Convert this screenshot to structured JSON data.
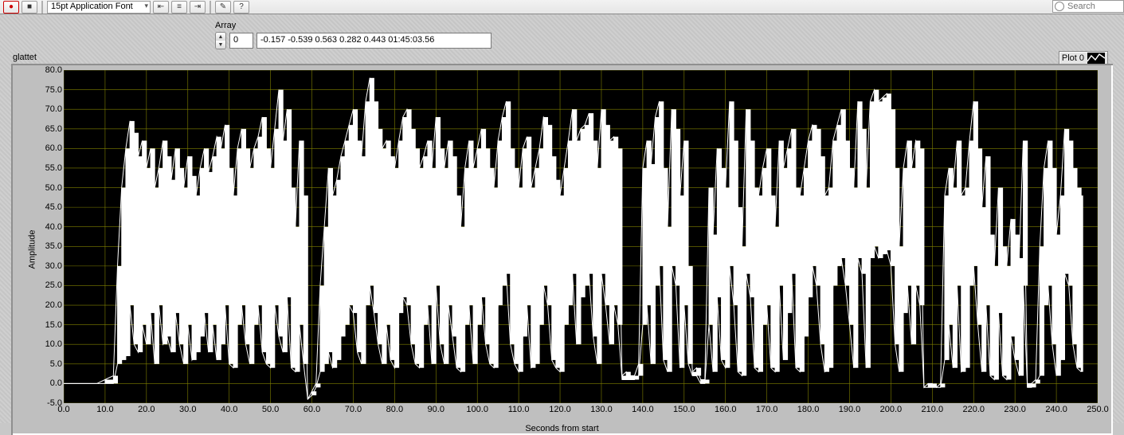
{
  "toolbar": {
    "record": "●",
    "stop": "■",
    "font_select": "15pt Application Font",
    "align_left": "⇤",
    "align_center": "≡",
    "align_right": "⇥",
    "tool1": "✎",
    "tool2": "?",
    "search_placeholder": "Search"
  },
  "array_ctrl": {
    "label": "Array",
    "index": "0",
    "value": "-0.157 -0.539 0.563 0.282 0.443  01:45:03.56"
  },
  "chart": {
    "label": "glattet",
    "legend": "Plot 0",
    "ytitle": "Amplitude",
    "xtitle": "Seconds from start"
  },
  "chart_data": {
    "type": "line",
    "title": "",
    "xlabel": "Seconds from start",
    "ylabel": "Amplitude",
    "xlim": [
      0,
      250
    ],
    "ylim": [
      -5,
      80
    ],
    "xticks": [
      0,
      10,
      20,
      30,
      40,
      50,
      60,
      70,
      80,
      90,
      100,
      110,
      120,
      130,
      140,
      150,
      160,
      170,
      180,
      190,
      200,
      210,
      220,
      230,
      240,
      250
    ],
    "yticks": [
      -5,
      0,
      5,
      10,
      15,
      20,
      25,
      30,
      35,
      40,
      45,
      50,
      55,
      60,
      65,
      70,
      75,
      80
    ],
    "x": [
      0,
      2,
      4,
      6,
      8,
      10,
      12,
      13,
      14,
      15,
      16,
      17,
      18,
      19,
      20,
      21,
      22,
      23,
      24,
      25,
      26,
      27,
      28,
      29,
      30,
      31,
      32,
      33,
      34,
      35,
      36,
      37,
      38,
      39,
      40,
      41,
      42,
      43,
      44,
      45,
      46,
      47,
      48,
      49,
      50,
      51,
      52,
      53,
      54,
      55,
      56,
      57,
      58,
      59,
      60,
      61,
      62,
      63,
      64,
      65,
      66,
      67,
      68,
      69,
      70,
      71,
      72,
      73,
      74,
      75,
      76,
      77,
      78,
      79,
      80,
      81,
      82,
      83,
      84,
      85,
      86,
      87,
      88,
      89,
      90,
      91,
      92,
      93,
      94,
      95,
      96,
      97,
      98,
      99,
      100,
      101,
      102,
      103,
      104,
      105,
      106,
      107,
      108,
      109,
      110,
      111,
      112,
      113,
      114,
      115,
      116,
      117,
      118,
      119,
      120,
      121,
      122,
      123,
      124,
      125,
      126,
      127,
      128,
      129,
      130,
      131,
      132,
      133,
      134,
      135,
      136,
      137,
      138,
      139,
      140,
      141,
      142,
      143,
      144,
      145,
      146,
      147,
      148,
      149,
      150,
      151,
      152,
      153,
      154,
      155,
      156,
      157,
      158,
      159,
      160,
      161,
      162,
      163,
      164,
      165,
      166,
      167,
      168,
      169,
      170,
      171,
      172,
      173,
      174,
      175,
      176,
      177,
      178,
      179,
      180,
      181,
      182,
      183,
      184,
      185,
      186,
      187,
      188,
      189,
      190,
      191,
      192,
      193,
      194,
      195,
      196,
      197,
      198,
      199,
      200,
      201,
      202,
      203,
      204,
      205,
      206,
      207,
      208,
      209,
      210,
      211,
      212,
      213,
      214,
      215,
      216,
      217,
      218,
      219,
      220,
      221,
      222,
      223,
      224,
      225,
      226,
      227,
      228,
      229,
      230,
      231,
      232,
      233,
      234,
      235,
      236,
      237,
      238,
      239,
      240,
      241,
      242,
      243,
      244,
      245,
      246
    ],
    "envelope_high": [
      0,
      0,
      0,
      0,
      0,
      1,
      2,
      30,
      50,
      60,
      67,
      64,
      58,
      62,
      55,
      60,
      50,
      55,
      62,
      58,
      52,
      60,
      55,
      50,
      58,
      53,
      48,
      55,
      60,
      54,
      58,
      63,
      60,
      66,
      55,
      48,
      60,
      65,
      60,
      55,
      60,
      63,
      68,
      60,
      55,
      65,
      75,
      62,
      70,
      50,
      40,
      62,
      48,
      -4,
      -2,
      0,
      25,
      40,
      55,
      48,
      52,
      58,
      62,
      66,
      70,
      62,
      58,
      72,
      78,
      72,
      65,
      60,
      62,
      58,
      55,
      62,
      68,
      70,
      65,
      60,
      55,
      58,
      62,
      55,
      68,
      60,
      55,
      62,
      58,
      48,
      40,
      55,
      62,
      55,
      60,
      65,
      60,
      55,
      50,
      62,
      68,
      72,
      60,
      55,
      50,
      60,
      63,
      50,
      55,
      60,
      68,
      66,
      58,
      52,
      48,
      55,
      62,
      70,
      62,
      65,
      66,
      69,
      62,
      55,
      70,
      66,
      62,
      63,
      60,
      2,
      3,
      2,
      2,
      5,
      55,
      62,
      56,
      68,
      72,
      55,
      40,
      70,
      65,
      48,
      62,
      30,
      3,
      4,
      1,
      1,
      50,
      38,
      60,
      55,
      50,
      72,
      62,
      45,
      35,
      70,
      62,
      50,
      48,
      55,
      60,
      48,
      40,
      62,
      55,
      60,
      65,
      50,
      48,
      55,
      62,
      66,
      65,
      58,
      48,
      50,
      62,
      66,
      70,
      62,
      55,
      50,
      72,
      65,
      50,
      72,
      75,
      72,
      73,
      74,
      70,
      55,
      35,
      55,
      62,
      55,
      62,
      60,
      -1,
      0,
      0,
      -1,
      0,
      48,
      55,
      50,
      62,
      48,
      50,
      62,
      72,
      60,
      45,
      58,
      38,
      30,
      50,
      35,
      30,
      42,
      38,
      32,
      62,
      0,
      0,
      1,
      35,
      55,
      62,
      55,
      38,
      48,
      65,
      62,
      55,
      50,
      48
    ],
    "envelope_low": [
      0,
      0,
      0,
      0,
      0,
      0,
      0,
      5,
      6,
      7,
      20,
      10,
      8,
      15,
      10,
      18,
      5,
      20,
      10,
      12,
      8,
      18,
      10,
      5,
      15,
      6,
      8,
      12,
      18,
      8,
      15,
      6,
      10,
      20,
      5,
      4,
      15,
      20,
      10,
      5,
      15,
      20,
      8,
      5,
      4,
      20,
      12,
      8,
      22,
      4,
      3,
      15,
      5,
      -4,
      -3,
      -1,
      3,
      5,
      8,
      4,
      6,
      12,
      15,
      20,
      18,
      8,
      5,
      20,
      25,
      18,
      10,
      5,
      15,
      6,
      4,
      18,
      22,
      20,
      10,
      5,
      4,
      15,
      20,
      5,
      25,
      10,
      5,
      20,
      12,
      4,
      3,
      15,
      20,
      5,
      15,
      22,
      10,
      5,
      4,
      20,
      25,
      28,
      10,
      5,
      3,
      12,
      20,
      4,
      5,
      15,
      25,
      20,
      6,
      4,
      3,
      15,
      20,
      28,
      10,
      22,
      25,
      28,
      12,
      5,
      28,
      20,
      10,
      20,
      15,
      1,
      1,
      1,
      1,
      2,
      15,
      20,
      5,
      25,
      30,
      6,
      3,
      30,
      25,
      4,
      20,
      5,
      2,
      2,
      0,
      0,
      15,
      3,
      22,
      6,
      4,
      30,
      20,
      3,
      2,
      28,
      22,
      4,
      3,
      15,
      20,
      4,
      3,
      25,
      6,
      18,
      28,
      4,
      3,
      12,
      22,
      30,
      25,
      10,
      3,
      4,
      25,
      30,
      32,
      25,
      15,
      4,
      32,
      28,
      4,
      32,
      35,
      32,
      33,
      34,
      30,
      10,
      3,
      18,
      25,
      10,
      25,
      20,
      -1,
      -1,
      -1,
      -1,
      -1,
      6,
      15,
      4,
      25,
      3,
      4,
      25,
      30,
      15,
      3,
      20,
      2,
      1,
      18,
      2,
      1,
      12,
      6,
      2,
      25,
      -1,
      -1,
      0,
      2,
      20,
      25,
      10,
      2,
      6,
      28,
      25,
      10,
      4,
      3
    ]
  }
}
